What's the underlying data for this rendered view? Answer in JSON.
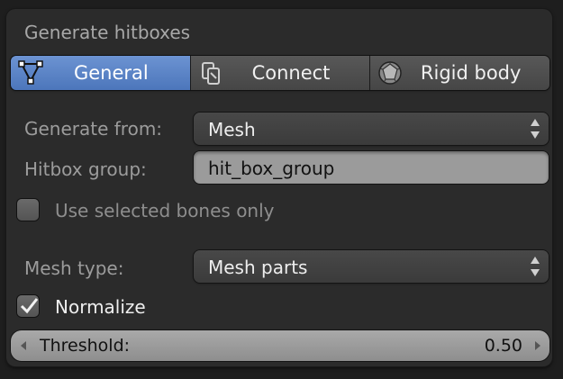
{
  "panel": {
    "title": "Generate hitboxes"
  },
  "tabs": [
    {
      "label": "General",
      "icon": "mesh-vertices-icon",
      "active": true
    },
    {
      "label": "Connect",
      "icon": "constraint-link-icon",
      "active": false
    },
    {
      "label": "Rigid body",
      "icon": "rigid-body-icon",
      "active": false
    }
  ],
  "generate_from": {
    "label": "Generate from:",
    "value": "Mesh"
  },
  "hitbox_group": {
    "label": "Hitbox group:",
    "value": "hit_box_group"
  },
  "use_selected_bones": {
    "label": "Use selected bones only",
    "checked": false
  },
  "mesh_type": {
    "label": "Mesh type:",
    "value": "Mesh parts"
  },
  "normalize": {
    "label": "Normalize",
    "checked": true
  },
  "threshold": {
    "label": "Threshold:",
    "value": "0.50"
  },
  "colors": {
    "accent": "#5a84c7",
    "panel": "#2b2b2b",
    "background": "#1e1e1e"
  }
}
